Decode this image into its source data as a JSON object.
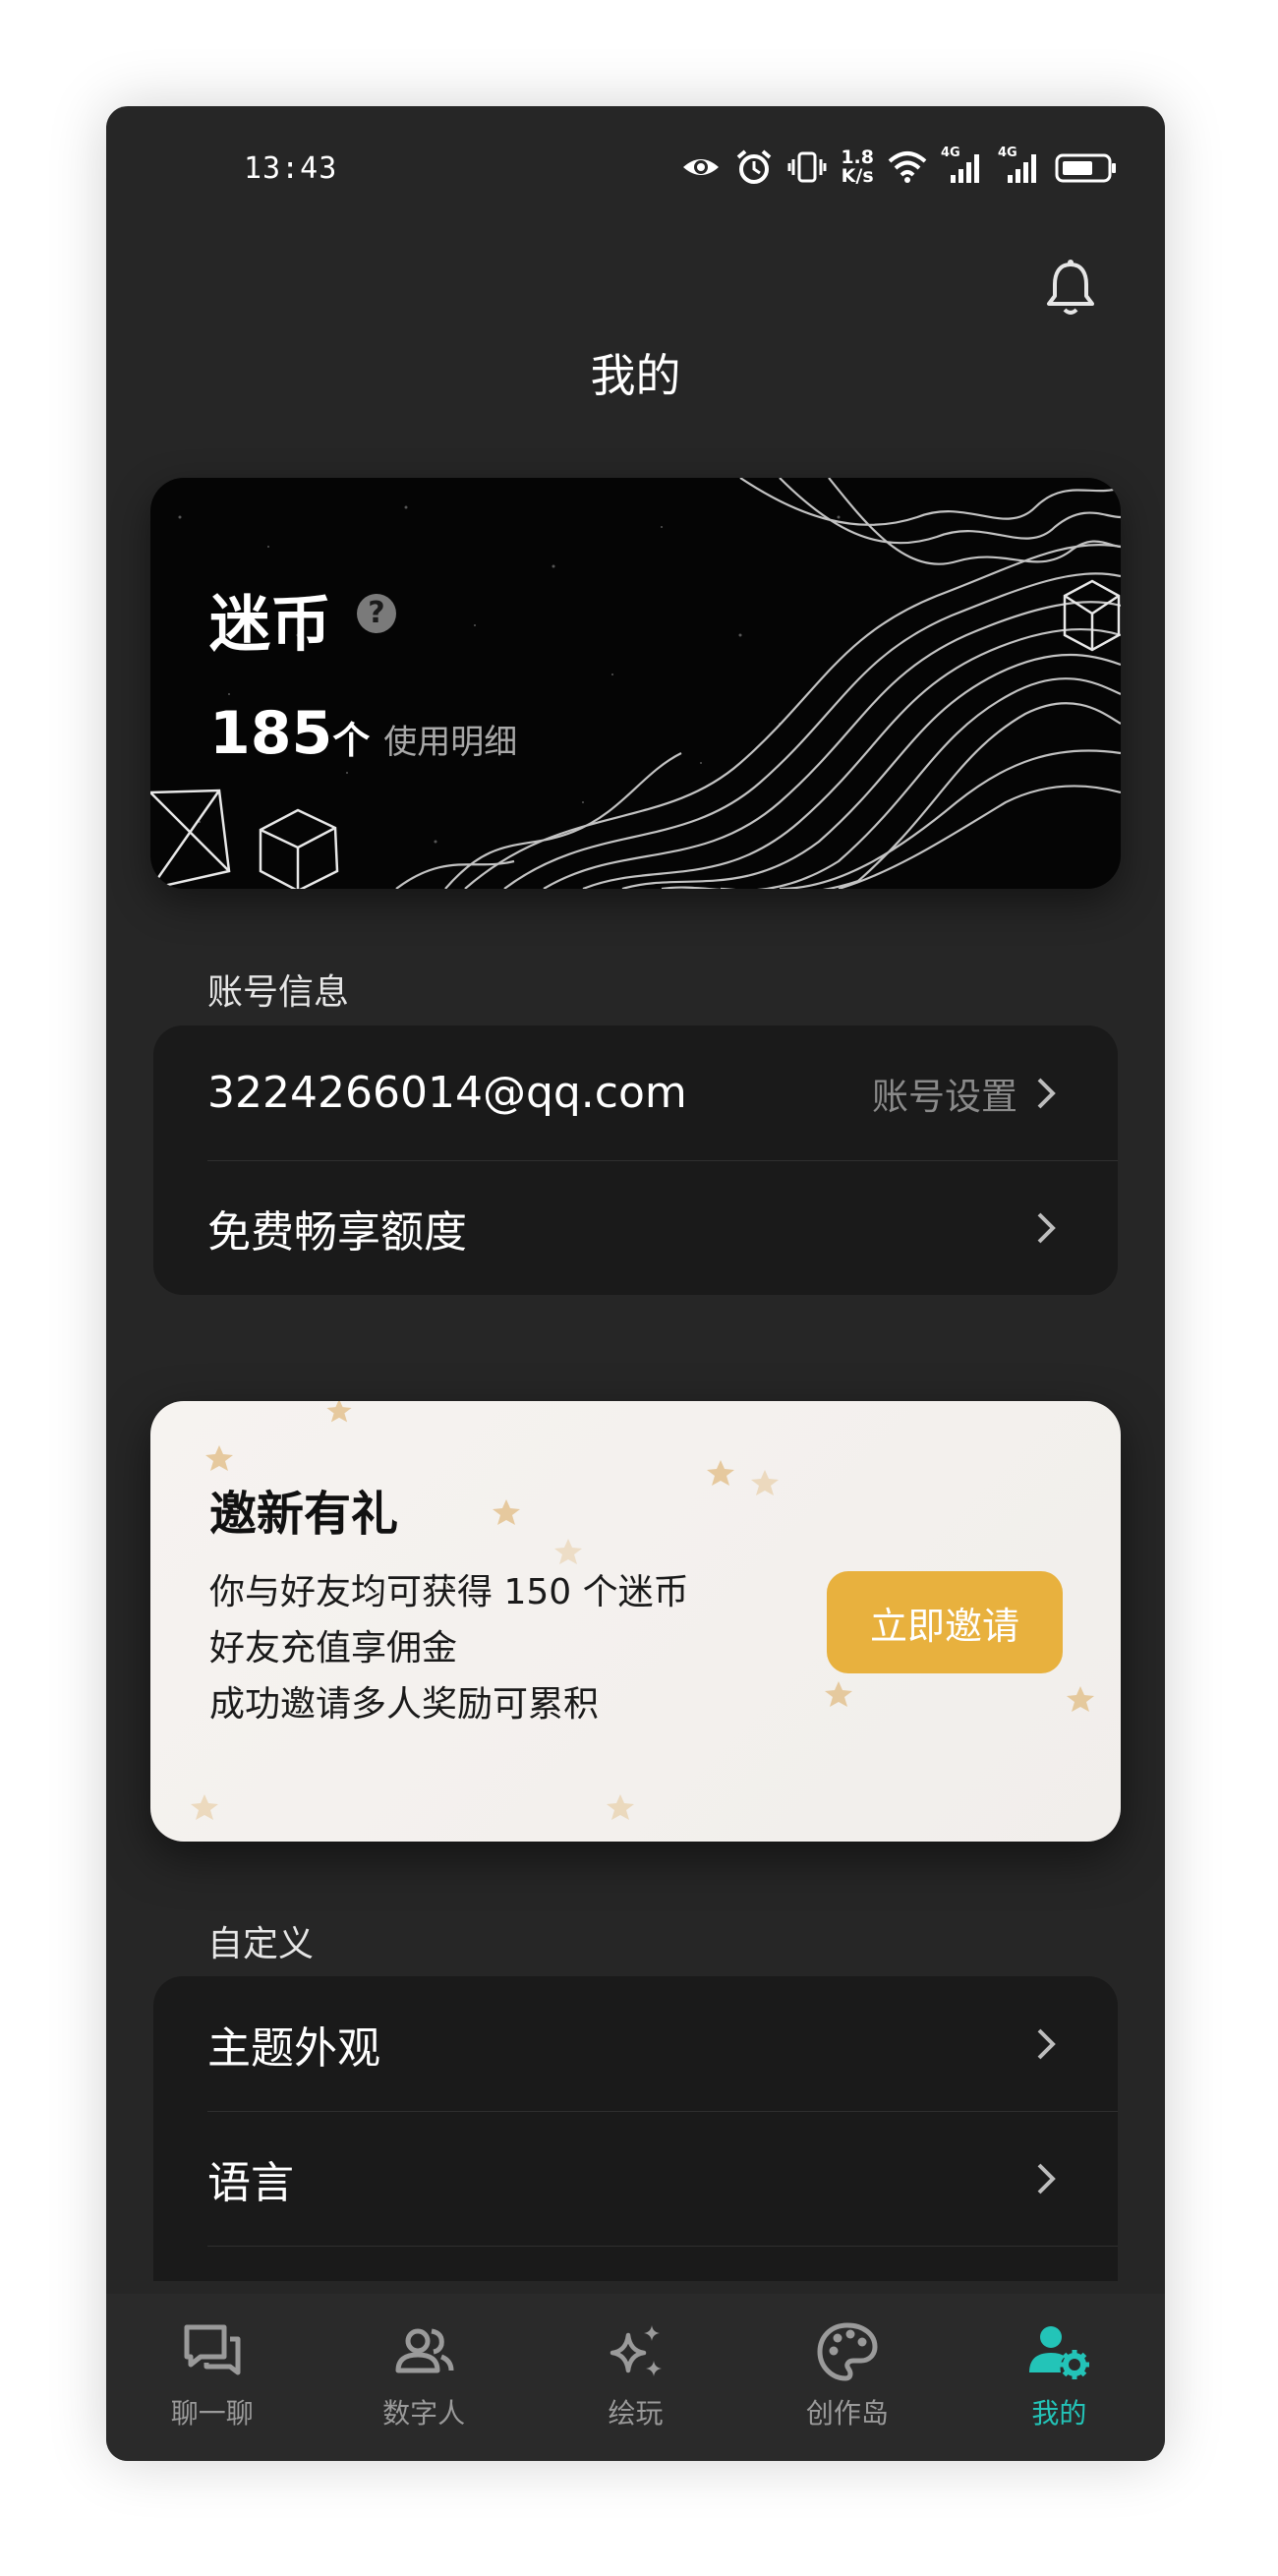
{
  "status_bar": {
    "time": "13:43",
    "net_speed_value": "1.8",
    "net_speed_unit": "K/s",
    "signal_1_label": "4G",
    "signal_2_label": "4G",
    "icons": [
      "eye-icon",
      "alarm-icon",
      "vibrate-icon",
      "wifi-icon",
      "signal-icon",
      "signal-icon",
      "battery-icon"
    ]
  },
  "header": {
    "title": "我的",
    "notification_icon": "bell-icon"
  },
  "coin_card": {
    "title": "迷币",
    "help_symbol": "?",
    "amount": "185",
    "unit": "个",
    "detail_link": "使用明细"
  },
  "account_section": {
    "label": "账号信息",
    "rows": [
      {
        "label": "3224266014@qq.com",
        "hint": "账号设置"
      },
      {
        "label": "免费畅享额度",
        "hint": ""
      }
    ]
  },
  "invite_card": {
    "title": "邀新有礼",
    "lines": [
      "你与好友均可获得 150 个迷币",
      "好友充值享佣金",
      "成功邀请多人奖励可累积"
    ],
    "button_label": "立即邀请",
    "button_color": "#e8b13e"
  },
  "custom_section": {
    "label": "自定义",
    "rows": [
      {
        "label": "主题外观"
      },
      {
        "label": "语言"
      }
    ]
  },
  "tab_bar": {
    "active_color": "#23c4b8",
    "tabs": [
      {
        "label": "聊一聊",
        "icon": "chat-icon",
        "active": false
      },
      {
        "label": "数字人",
        "icon": "people-icon",
        "active": false
      },
      {
        "label": "绘玩",
        "icon": "sparkle-icon",
        "active": false
      },
      {
        "label": "创作岛",
        "icon": "palette-icon",
        "active": false
      },
      {
        "label": "我的",
        "icon": "user-settings-icon",
        "active": true
      }
    ]
  }
}
